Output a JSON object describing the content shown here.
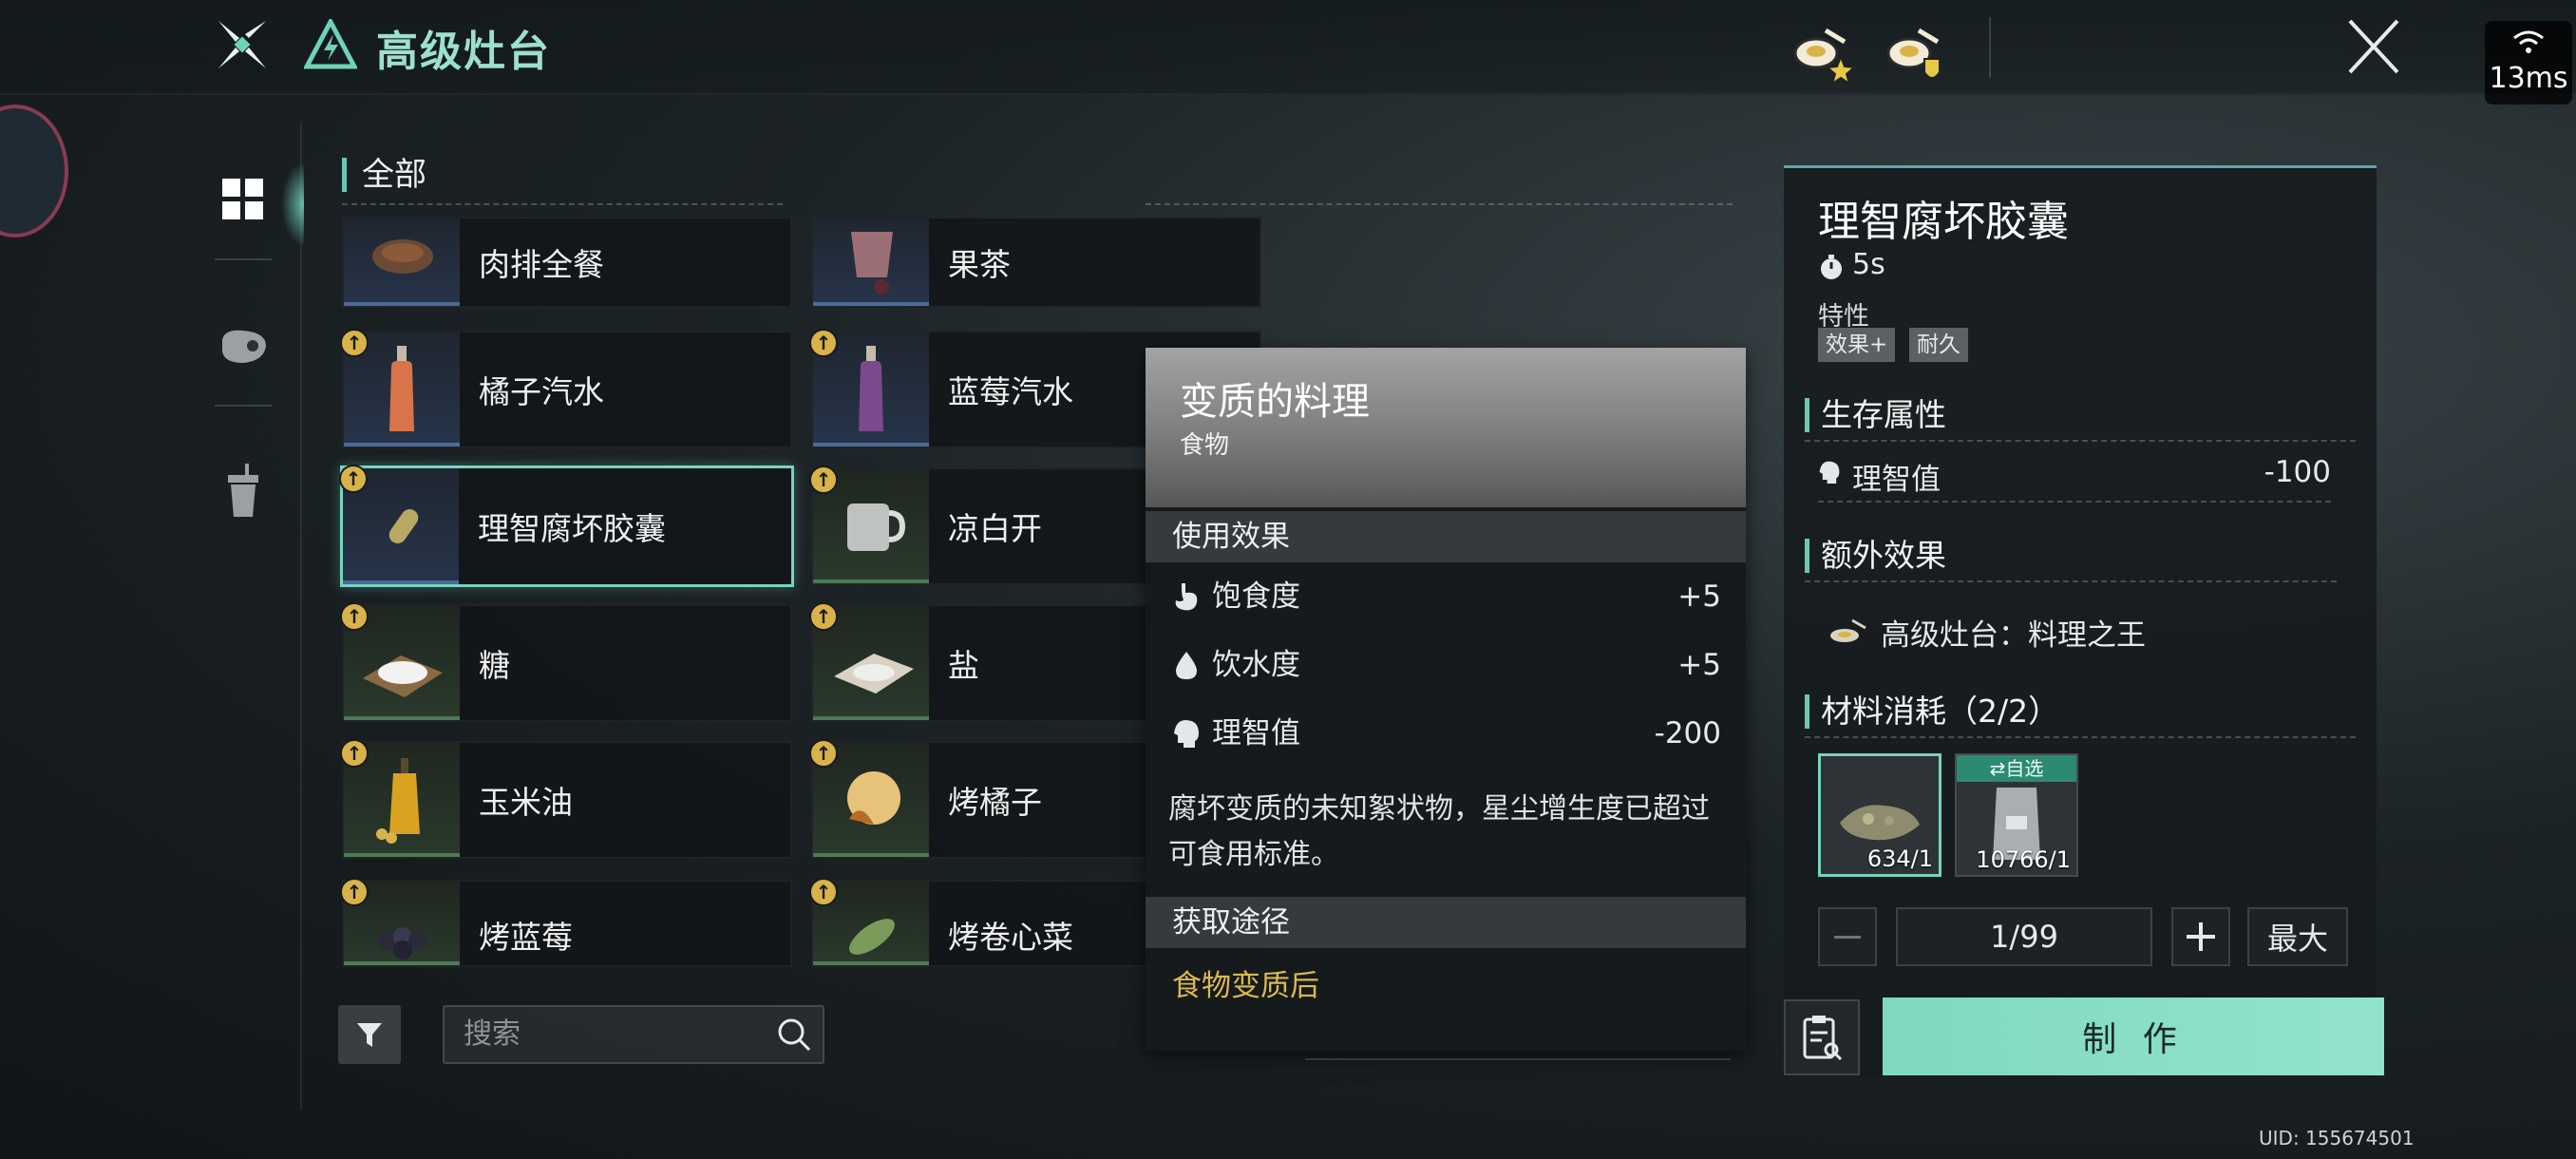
{
  "header": {
    "title": "高级灶台",
    "network_latency": "13ms"
  },
  "list": {
    "section_title": "全部",
    "items": [
      {
        "name": "肉排全餐",
        "upgrade": false
      },
      {
        "name": "果茶",
        "upgrade": false
      },
      {
        "name": "橘子汽水",
        "upgrade": true
      },
      {
        "name": "蓝莓汽水",
        "upgrade": true
      },
      {
        "name": "理智腐坏胶囊",
        "upgrade": true,
        "selected": true
      },
      {
        "name": "凉白开",
        "upgrade": true
      },
      {
        "name": "糖",
        "upgrade": true
      },
      {
        "name": "盐",
        "upgrade": true
      },
      {
        "name": "玉米油",
        "upgrade": true
      },
      {
        "name": "烤橘子",
        "upgrade": true
      },
      {
        "name": "烤蓝莓",
        "upgrade": true
      },
      {
        "name": "烤卷心菜",
        "upgrade": true
      }
    ],
    "search_placeholder": "搜索"
  },
  "tooltip": {
    "title": "变质的料理",
    "subtitle": "食物",
    "use_effect_label": "使用效果",
    "stats": [
      {
        "label": "饱食度",
        "value": "+5",
        "icon": "stomach-icon"
      },
      {
        "label": "饮水度",
        "value": "+5",
        "icon": "water-drop-icon"
      },
      {
        "label": "理智值",
        "value": "-200",
        "icon": "head-icon"
      }
    ],
    "description": "腐坏变质的未知絮状物，星尘增生度已超过可食用标准。",
    "source_label": "获取途径",
    "source": "食物变质后"
  },
  "detail": {
    "title": "理智腐坏胶囊",
    "time": "5s",
    "traits_label": "特性",
    "traits": [
      "效果+",
      "耐久"
    ],
    "survival_label": "生存属性",
    "survival": {
      "label": "理智值",
      "value": "-100"
    },
    "extra_label": "额外效果",
    "extra_effect": "高级灶台：料理之王",
    "materials_label": "材料消耗（2/2）",
    "materials": [
      {
        "count": "634/1"
      },
      {
        "count": "10766/1",
        "tag": "自选"
      }
    ],
    "quantity": "1/99",
    "max_label": "最大",
    "make_label": "制 作"
  },
  "footer": {
    "uid": "UID: 155674501"
  },
  "colors": {
    "accent": "#74d5bf",
    "gold": "#dcb84e",
    "make_button": "#86dcc3"
  }
}
